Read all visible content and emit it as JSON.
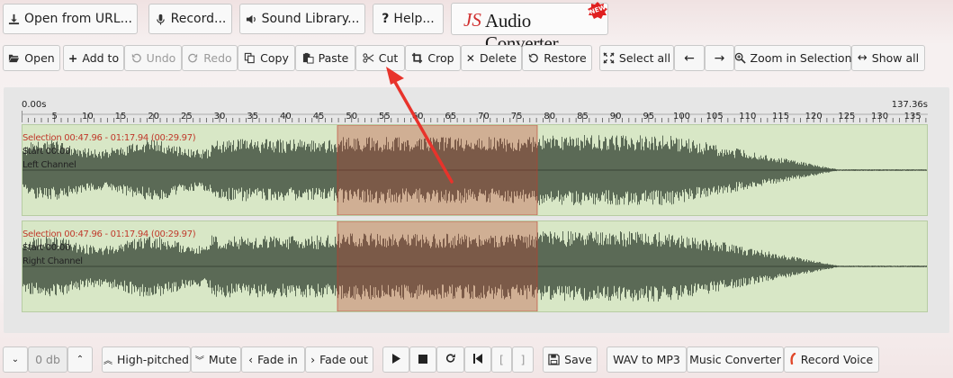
{
  "header": {
    "open_url": "Open from URL...",
    "record": "Record...",
    "sound_library": "Sound Library...",
    "help": "Help...",
    "logo_js": "JS",
    "logo_text": "Audio Converter",
    "logo_badge": "NEW"
  },
  "toolbar": {
    "open": "Open",
    "add_to": "Add to",
    "undo": "Undo",
    "redo": "Redo",
    "copy": "Copy",
    "paste": "Paste",
    "cut": "Cut",
    "crop": "Crop",
    "delete": "Delete",
    "restore": "Restore",
    "select_all": "Select all",
    "zoom_in_selection": "Zoom in Selection",
    "show_all": "Show all"
  },
  "ruler": {
    "start_label": "0.00s",
    "end_label": "137.36s",
    "ticks": [
      "5",
      "10",
      "15",
      "20",
      "25",
      "30",
      "35",
      "40",
      "45",
      "50",
      "55",
      "60",
      "65",
      "70",
      "75",
      "80",
      "85",
      "90",
      "95",
      "100",
      "105",
      "110",
      "115",
      "120",
      "125",
      "130",
      "135"
    ]
  },
  "channels": [
    {
      "selection": "Selection 00:47.96 - 01:17.94 (00:29.97)",
      "start": "Start 00:00",
      "name": "Left Channel"
    },
    {
      "selection": "Selection 00:47.96 - 01:17.94 (00:29.97)",
      "start": "Start 00:00",
      "name": "Right Channel"
    }
  ],
  "bottom": {
    "volume": "0 db",
    "high_pitched": "High-pitched",
    "mute": "Mute",
    "fade_in": "Fade in",
    "fade_out": "Fade out",
    "bracket_open": "[",
    "bracket_close": "]",
    "save": "Save",
    "wav_to_mp3": "WAV to MP3",
    "music_converter": "Music Converter",
    "record_voice": "Record Voice"
  },
  "colors": {
    "waveform": "#5b6a56",
    "channel_bg": "#d8e7c6",
    "selection_fill": "#c0392b",
    "annotation_arrow": "#e8332b"
  },
  "icons": {
    "open_url": "download-icon",
    "record": "microphone-icon",
    "sound_library": "volume-icon",
    "help": "question-icon",
    "cut": "scissors-icon",
    "crop": "crop-icon"
  }
}
